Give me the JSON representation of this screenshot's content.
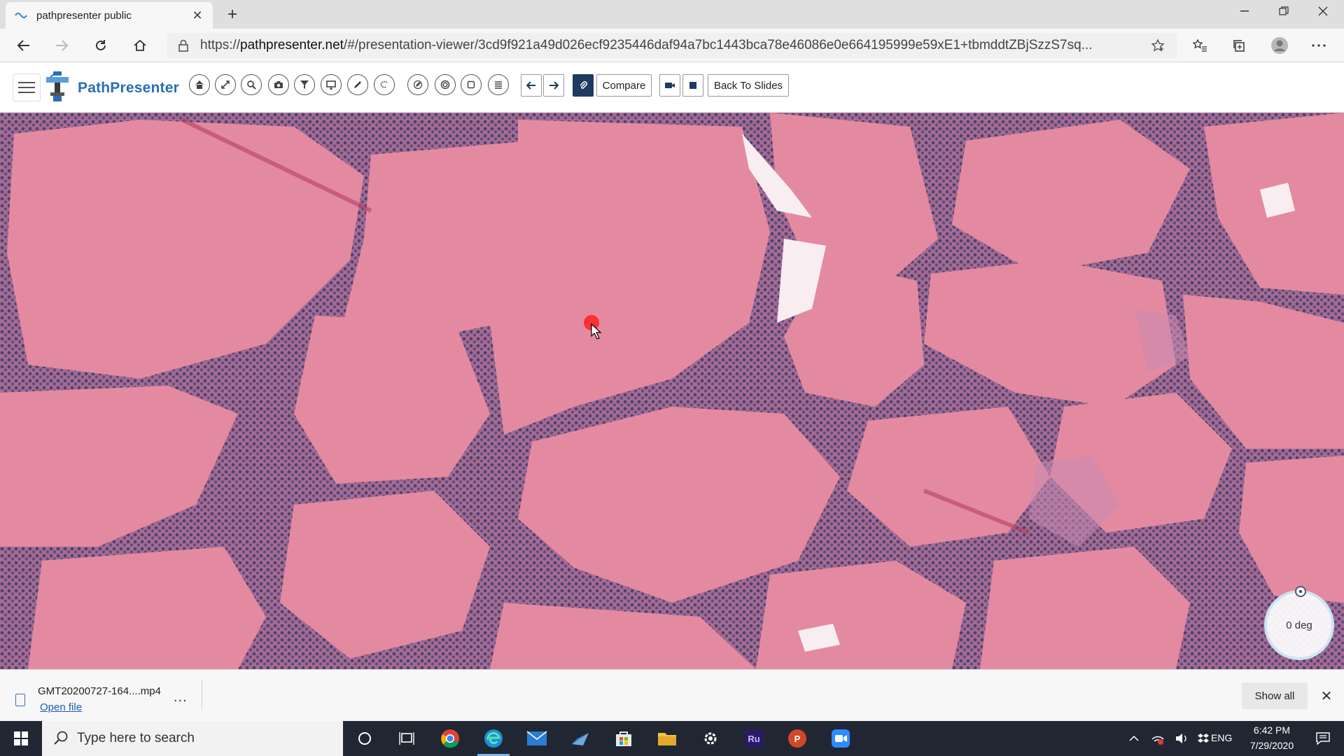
{
  "browser": {
    "tab_title": "pathpresenter public",
    "url_prefix": "https://",
    "url_host": "pathpresenter.net",
    "url_path": "/#/presentation-viewer/3cd9f921a49d026ecf9235446daf94a7bc1443bca78e46086e0e664195999e59xE1+tbmddtZBjSzzS7sq..."
  },
  "app": {
    "brand": "PathPresenter",
    "toolbar": {
      "compare_label": "Compare",
      "back_label": "Back To Slides"
    }
  },
  "viewer": {
    "rotation_label": "0 deg"
  },
  "downloads": {
    "file_name": "GMT20200727-164....mp4",
    "open_label": "Open file",
    "more_label": "...",
    "show_all_label": "Show all"
  },
  "taskbar": {
    "search_placeholder": "Type here to search",
    "language": "ENG",
    "time": "6:42 PM",
    "date": "7/29/2020"
  },
  "colors": {
    "brand_blue": "#2a6fb2",
    "tissue_pink": "#e48aa0",
    "nuclei": "#4a4570",
    "taskbar": "#202733"
  }
}
